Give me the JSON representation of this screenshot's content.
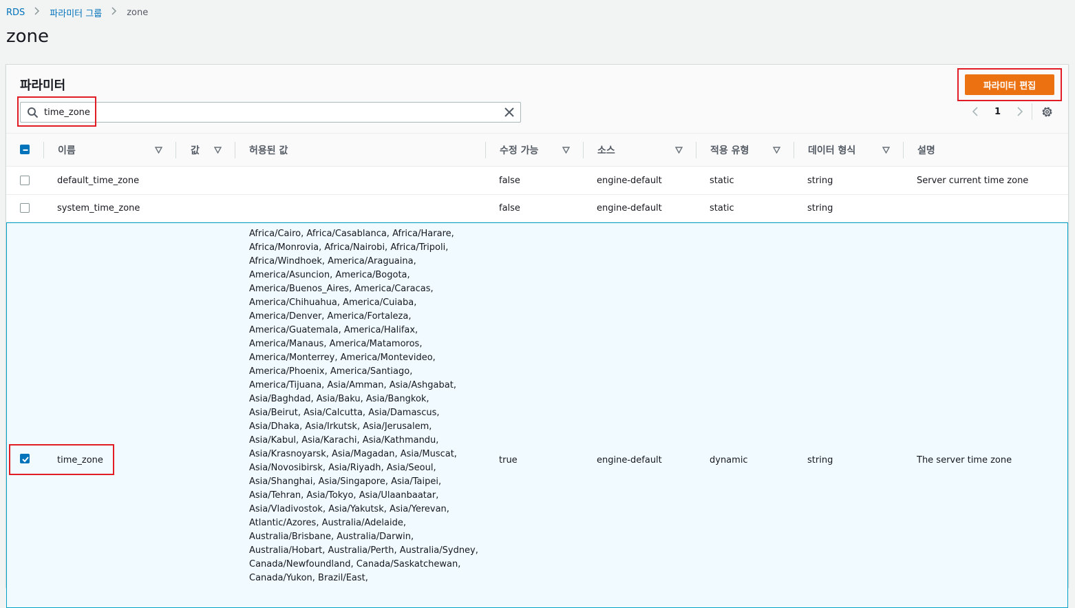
{
  "breadcrumb": {
    "items": [
      "RDS",
      "파라미터 그룹"
    ],
    "current": "zone"
  },
  "page": {
    "title": "zone"
  },
  "panel": {
    "title": "파라미터",
    "edit_button_label": "파라미터 편집",
    "search": {
      "value": "time_zone",
      "placeholder": ""
    },
    "pager": {
      "page": "1"
    }
  },
  "columns": [
    "이름",
    "값",
    "허용된 값",
    "수정 가능",
    "소스",
    "적용 유형",
    "데이터 형식",
    "설명"
  ],
  "rows": [
    {
      "name": "default_time_zone",
      "value": "",
      "allowed": "",
      "modifiable": "false",
      "source": "engine-default",
      "apply_type": "static",
      "data_type": "string",
      "description": "Server current time zone",
      "checked": false
    },
    {
      "name": "system_time_zone",
      "value": "",
      "allowed": "",
      "modifiable": "false",
      "source": "engine-default",
      "apply_type": "static",
      "data_type": "string",
      "description": "",
      "checked": false
    },
    {
      "name": "time_zone",
      "value": "",
      "allowed": "Africa/Cairo, Africa/Casablanca, Africa/Harare, Africa/Monrovia, Africa/Nairobi, Africa/Tripoli, Africa/Windhoek, America/Araguaina, America/Asuncion, America/Bogota, America/Buenos_Aires, America/Caracas, America/Chihuahua, America/Cuiaba, America/Denver, America/Fortaleza, America/Guatemala, America/Halifax, America/Manaus, America/Matamoros, America/Monterrey, America/Montevideo, America/Phoenix, America/Santiago, America/Tijuana, Asia/Amman, Asia/Ashgabat, Asia/Baghdad, Asia/Baku, Asia/Bangkok, Asia/Beirut, Asia/Calcutta, Asia/Damascus, Asia/Dhaka, Asia/Irkutsk, Asia/Jerusalem, Asia/Kabul, Asia/Karachi, Asia/Kathmandu, Asia/Krasnoyarsk, Asia/Magadan, Asia/Muscat, Asia/Novosibirsk, Asia/Riyadh, Asia/Seoul, Asia/Shanghai, Asia/Singapore, Asia/Taipei, Asia/Tehran, Asia/Tokyo, Asia/Ulaanbaatar, Asia/Vladivostok, Asia/Yakutsk, Asia/Yerevan, Atlantic/Azores, Australia/Adelaide, Australia/Brisbane, Australia/Darwin, Australia/Hobart, Australia/Perth, Australia/Sydney, Canada/Newfoundland, Canada/Saskatchewan, Canada/Yukon, Brazil/East,",
      "modifiable": "true",
      "source": "engine-default",
      "apply_type": "dynamic",
      "data_type": "string",
      "description": "The server time zone",
      "checked": true
    }
  ],
  "colors": {
    "accent": "#0073bb",
    "primary_button": "#ec7211",
    "highlight": "#e01b24",
    "selected_row": "#f1faff"
  }
}
